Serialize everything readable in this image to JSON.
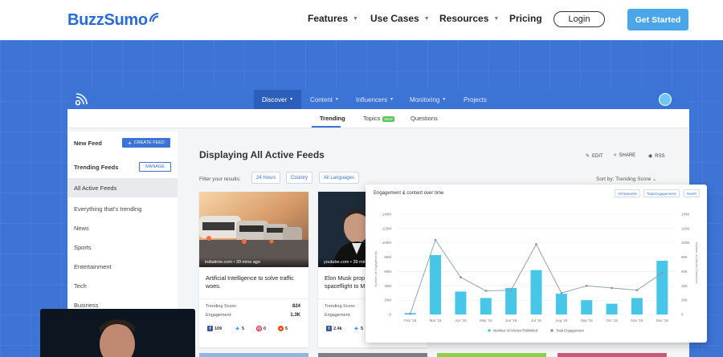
{
  "site_nav": {
    "logo": "BuzzSumo",
    "items": [
      "Features",
      "Use Cases",
      "Resources",
      "Pricing"
    ],
    "login": "Login",
    "get_started": "Get Started"
  },
  "app": {
    "nav": [
      "Discover",
      "Content",
      "Influencers",
      "Monitoring",
      "Projects"
    ],
    "subtabs": [
      "Trending",
      "Topics",
      "Questions"
    ],
    "new_badge": "NEW",
    "sidebar": {
      "new_feed": "New Feed",
      "create_feed": "CREATE FEED",
      "trending_feeds": "Trending Feeds",
      "manage": "MANAGE",
      "items": [
        "All Active Feeds",
        "Everything that's trending",
        "News",
        "Sports",
        "Entertainment",
        "Tech",
        "Business"
      ]
    },
    "main": {
      "heading": "Displaying All Active Feeds",
      "actions": {
        "edit": "EDIT",
        "share": "SHARE",
        "rss": "RSS"
      },
      "filter_label": "Filter your results:",
      "filters": [
        "24 Hours",
        "Country",
        "All Languages"
      ],
      "sort": "Sort by: Trending Score"
    },
    "cards": [
      {
        "source": "indiatime.com • 39 mins ago",
        "title": "Artificial Intelligence to solve traffic woes.",
        "score_label": "Trending Score:",
        "score": "824",
        "engagement_label": "Engagement:",
        "engagement": "1.3K",
        "social": {
          "facebook": "109",
          "twitter": "5",
          "pinterest": "0",
          "reddit": "5"
        }
      },
      {
        "source": "youtube.com • 39 mins ago",
        "title": "Elon Musk prop controversial pl spaceflight to M",
        "score_label": "Trending Score:",
        "score": "",
        "engagement_label": "Engagement:",
        "engagement": "",
        "social": {
          "facebook": "2.4k",
          "twitter": "5"
        }
      }
    ]
  },
  "chart_panel": {
    "title": "Engagement & content over time",
    "buttons": [
      "All Networks",
      "Total Engagements",
      "Month"
    ],
    "legend": [
      "Number of Articles Published",
      "Total Engagement"
    ],
    "colors": {
      "bars": "#48c6e8",
      "line": "#8a9aad"
    }
  },
  "chart_data": {
    "type": "bar",
    "categories": [
      "Feb '18",
      "Mar '18",
      "Apr '18",
      "May '18",
      "Jun '18",
      "Jul '18",
      "Aug '18",
      "Sep '18",
      "Oct '18",
      "Nov '18",
      "Dec '18"
    ],
    "y_left_ticks": [
      "0",
      "20M",
      "40M",
      "60M",
      "80M",
      "100M",
      "120M",
      "140M"
    ],
    "y_right_ticks": [
      "0",
      "20K",
      "40K",
      "60K",
      "80K",
      "100K",
      "120K",
      "140K"
    ],
    "ylim_left": [
      0,
      140
    ],
    "ylim_right": [
      0,
      140
    ],
    "ylabel_left": "Number of Engagements",
    "ylabel_right": "Number of Articles Published",
    "series": [
      {
        "name": "Number of Articles Published",
        "type": "bar",
        "values": [
          2,
          83,
          32,
          23,
          37,
          62,
          29,
          20,
          15,
          23,
          75
        ]
      },
      {
        "name": "Total Engagement",
        "type": "line",
        "values": [
          1,
          104,
          52,
          33,
          34,
          98,
          30,
          40,
          37,
          34,
          58
        ]
      }
    ],
    "grid": true,
    "legend_position": "bottom"
  }
}
